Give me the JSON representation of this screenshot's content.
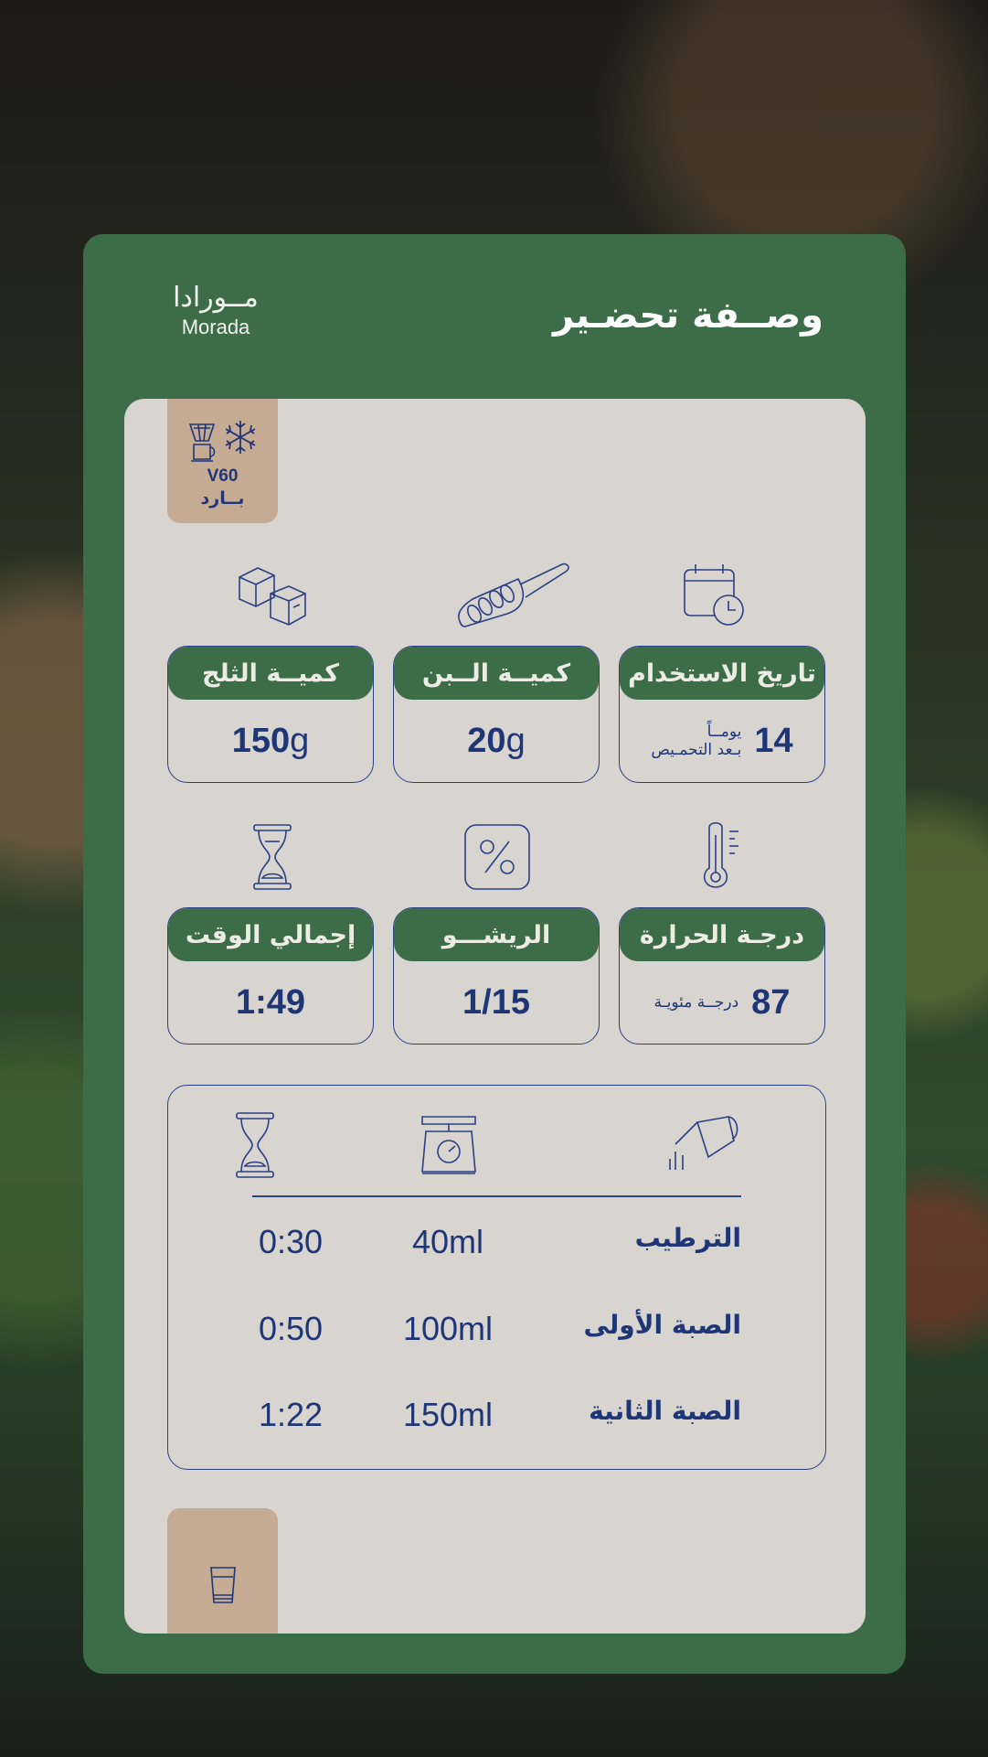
{
  "header": {
    "brand_ar": "مــورادا",
    "brand_en": "Morada",
    "title": "وصــفة تحضـير"
  },
  "tag": {
    "line1": "V60",
    "line2": "بــارد",
    "icons": [
      "dripper-icon",
      "snowflake-icon"
    ]
  },
  "stats": {
    "ice": {
      "label": "كميــة الثلج",
      "value": "150",
      "unit": "g",
      "icon": "ice-cubes-icon"
    },
    "coffee": {
      "label": "كميــة الــبن",
      "value": "20",
      "unit": "g",
      "icon": "coffee-scoop-icon"
    },
    "usage": {
      "label": "تاريخ الاستخدام",
      "value": "14",
      "note_line1": "يومــاً",
      "note_line2": "بـعد التحمـيص",
      "icon": "calendar-clock-icon"
    },
    "time": {
      "label": "إجمالي الوقت",
      "value": "1:49",
      "icon": "hourglass-icon"
    },
    "ratio": {
      "label": "الريشـــو",
      "value": "1/15",
      "icon": "percent-icon"
    },
    "temp": {
      "label": "درجـة الحرارة",
      "value": "87",
      "note": "درجــة مئويـة",
      "icon": "thermometer-icon"
    }
  },
  "pour": {
    "header_icons": [
      "hourglass-icon",
      "scale-icon",
      "kettle-icon"
    ],
    "rows": [
      {
        "label": "الترطيب",
        "ml": "40ml",
        "time": "0:30"
      },
      {
        "label": "الصبة الأولى",
        "ml": "100ml",
        "time": "0:50"
      },
      {
        "label": "الصبة الثانية",
        "ml": "150ml",
        "time": "1:22"
      }
    ]
  },
  "bottom_tag": {
    "icon": "cup-icon"
  },
  "colors": {
    "green": "#3d6d48",
    "navy": "#1f3676",
    "beige": "#d8d4cf",
    "tan": "#c5ab94"
  }
}
